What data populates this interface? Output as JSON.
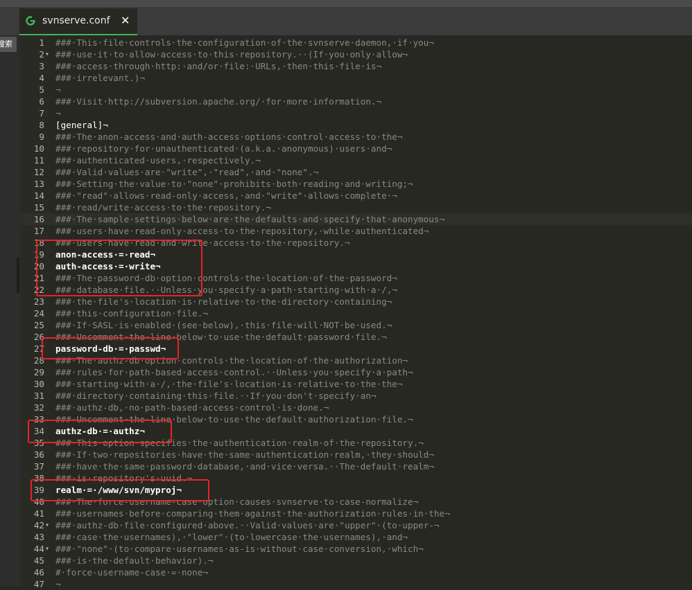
{
  "tab": {
    "title": "svnserve.conf",
    "close": "✕"
  },
  "sidebar": {
    "label": "搜索"
  },
  "lines": [
    {
      "n": "1",
      "text": "###·This·file·controls·the·configuration·of·the·svnserve·daemon,·if·you¬",
      "kind": "c"
    },
    {
      "n": "2",
      "text": "###·use·it·to·allow·access·to·this·repository.··(If·you·only·allow¬",
      "kind": "c",
      "fold": "▾"
    },
    {
      "n": "3",
      "text": "###·access·through·http:·and/or·file:·URLs,·then·this·file·is¬",
      "kind": "c"
    },
    {
      "n": "4",
      "text": "###·irrelevant.)¬",
      "kind": "c"
    },
    {
      "n": "5",
      "text": "¬",
      "kind": "c"
    },
    {
      "n": "6",
      "text": "###·Visit·http://subversion.apache.org/·for·more·information.¬",
      "kind": "c"
    },
    {
      "n": "7",
      "text": "¬",
      "kind": "c"
    },
    {
      "n": "8",
      "text": "[general]¬",
      "kind": "s"
    },
    {
      "n": "9",
      "text": "###·The·anon-access·and·auth-access·options·control·access·to·the¬",
      "kind": "c"
    },
    {
      "n": "10",
      "text": "###·repository·for·unauthenticated·(a.k.a.·anonymous)·users·and¬",
      "kind": "c"
    },
    {
      "n": "11",
      "text": "###·authenticated·users,·respectively.¬",
      "kind": "c"
    },
    {
      "n": "12",
      "text": "###·Valid·values·are·\"write\",·\"read\",·and·\"none\".¬",
      "kind": "c"
    },
    {
      "n": "13",
      "text": "###·Setting·the·value·to·\"none\"·prohibits·both·reading·and·writing;¬",
      "kind": "c"
    },
    {
      "n": "14",
      "text": "###·\"read\"·allows·read-only·access,·and·\"write\"·allows·complete·¬",
      "kind": "c"
    },
    {
      "n": "15",
      "text": "###·read/write·access·to·the·repository.¬",
      "kind": "c"
    },
    {
      "n": "16",
      "text": "###·The·sample·settings·below·are·the·defaults·and·specify·that·anonymous¬",
      "kind": "c",
      "cursor": true
    },
    {
      "n": "17",
      "text": "###·users·have·read-only·access·to·the·repository,·while·authenticated¬",
      "kind": "c"
    },
    {
      "n": "18",
      "text": "###·users·have·read·and·write·access·to·the·repository.¬",
      "kind": "c"
    },
    {
      "n": "19",
      "text": "anon-access·=·read¬",
      "kind": "k"
    },
    {
      "n": "20",
      "text": "auth-access·=·write¬",
      "kind": "k"
    },
    {
      "n": "21",
      "text": "###·The·password-db·option·controls·the·location·of·the·password¬",
      "kind": "c"
    },
    {
      "n": "22",
      "text": "###·database·file.··Unless·you·specify·a·path·starting·with·a·/,¬",
      "kind": "c"
    },
    {
      "n": "23",
      "text": "###·the·file's·location·is·relative·to·the·directory·containing¬",
      "kind": "c"
    },
    {
      "n": "24",
      "text": "###·this·configuration·file.¬",
      "kind": "c"
    },
    {
      "n": "25",
      "text": "###·If·SASL·is·enabled·(see·below),·this·file·will·NOT·be·used.¬",
      "kind": "c"
    },
    {
      "n": "26",
      "text": "###·Uncomment·the·line·below·to·use·the·default·password·file.¬",
      "kind": "c"
    },
    {
      "n": "27",
      "text": "password-db·=·passwd¬",
      "kind": "k"
    },
    {
      "n": "28",
      "text": "###·The·authz-db·option·controls·the·location·of·the·authorization¬",
      "kind": "c"
    },
    {
      "n": "29",
      "text": "###·rules·for·path-based·access·control.··Unless·you·specify·a·path¬",
      "kind": "c"
    },
    {
      "n": "30",
      "text": "###·starting·with·a·/,·the·file's·location·is·relative·to·the·the¬",
      "kind": "c"
    },
    {
      "n": "31",
      "text": "###·directory·containing·this·file.··If·you·don't·specify·an¬",
      "kind": "c"
    },
    {
      "n": "32",
      "text": "###·authz-db,·no·path-based·access·control·is·done.¬",
      "kind": "c"
    },
    {
      "n": "33",
      "text": "###·Uncomment·the·line·below·to·use·the·default·authorization·file.¬",
      "kind": "c"
    },
    {
      "n": "34",
      "text": "authz-db·=·authz¬",
      "kind": "k"
    },
    {
      "n": "35",
      "text": "###·This·option·specifies·the·authentication·realm·of·the·repository.¬",
      "kind": "c"
    },
    {
      "n": "36",
      "text": "###·If·two·repositories·have·the·same·authentication·realm,·they·should¬",
      "kind": "c"
    },
    {
      "n": "37",
      "text": "###·have·the·same·password·database,·and·vice·versa.··The·default·realm¬",
      "kind": "c"
    },
    {
      "n": "38",
      "text": "###·is·repository's·uuid.¬",
      "kind": "c"
    },
    {
      "n": "39",
      "text": "realm·=·/www/svn/myproj¬",
      "kind": "k"
    },
    {
      "n": "40",
      "text": "###·The·force-username-case·option·causes·svnserve·to·case-normalize¬",
      "kind": "c"
    },
    {
      "n": "41",
      "text": "###·usernames·before·comparing·them·against·the·authorization·rules·in·the¬",
      "kind": "c"
    },
    {
      "n": "42",
      "text": "###·authz-db·file·configured·above.··Valid·values·are·\"upper\"·(to·upper-¬",
      "kind": "c",
      "fold": "▾"
    },
    {
      "n": "43",
      "text": "###·case·the·usernames),·\"lower\"·(to·lowercase·the·usernames),·and¬",
      "kind": "c"
    },
    {
      "n": "44",
      "text": "###·\"none\"·(to·compare·usernames·as-is·without·case·conversion,·which¬",
      "kind": "c",
      "fold": "▾"
    },
    {
      "n": "45",
      "text": "###·is·the·default·behavior).¬",
      "kind": "c"
    },
    {
      "n": "46",
      "text": "#·force-username-case·=·none¬",
      "kind": "c"
    },
    {
      "n": "47",
      "text": "¬",
      "kind": "c"
    }
  ],
  "colors": {
    "accent": "#3fb65b",
    "highlight": "#e8232a",
    "comment": "#8a8a80",
    "keyword": "#ffffff"
  }
}
